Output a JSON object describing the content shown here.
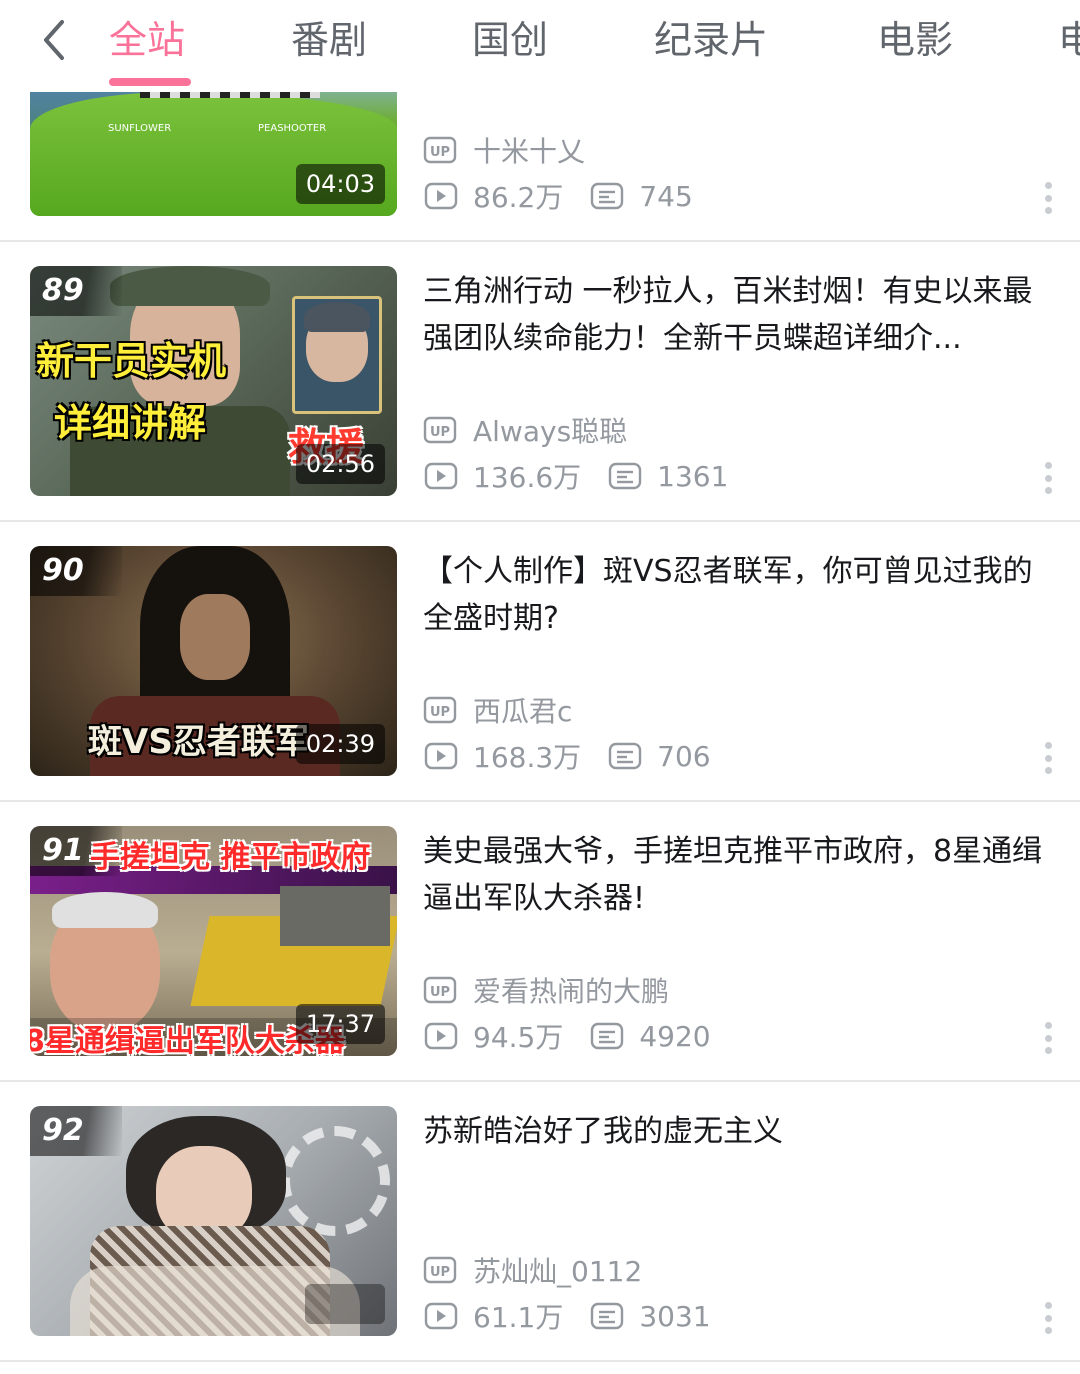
{
  "header": {
    "tabs": [
      {
        "label": "全站",
        "active": true
      },
      {
        "label": "番剧",
        "active": false
      },
      {
        "label": "国创",
        "active": false
      },
      {
        "label": "纪录片",
        "active": false
      },
      {
        "label": "电影",
        "active": false
      },
      {
        "label": "电",
        "active": false
      }
    ]
  },
  "colors": {
    "accent": "#fb7299",
    "meta": "#9499a0"
  },
  "icons": {
    "back": "chevron-left-icon",
    "uploader": "up-badge-icon",
    "views": "play-count-icon",
    "danmaku": "danmaku-count-icon",
    "more": "more-vertical-icon"
  },
  "items": [
    {
      "title": "",
      "uploader": "十米十乂",
      "views": "86.2万",
      "danmaku": "745",
      "duration": "04:03",
      "thumb_text": [
        "SUNFLOWER",
        "PEASHOOTER"
      ]
    },
    {
      "rank": "89",
      "title": "三角洲行动 一秒拉人，百米封烟！有史以来最强团队续命能力！全新干员蝶超详细介...",
      "uploader": "Always聪聪",
      "views": "136.6万",
      "danmaku": "1361",
      "duration": "02:56",
      "thumb_text": [
        "新干员实机",
        "详细讲解",
        "救援"
      ]
    },
    {
      "rank": "90",
      "title": "【个人制作】斑VS忍者联军，你可曾见过我的全盛时期?",
      "uploader": "西瓜君c",
      "views": "168.3万",
      "danmaku": "706",
      "duration": "02:39",
      "thumb_text": [
        "斑VS忍者联军"
      ]
    },
    {
      "rank": "91",
      "title": "美史最强大爷，手搓坦克推平市政府，8星通缉逼出军队大杀器!",
      "uploader": "爱看热闹的大鹏",
      "views": "94.5万",
      "danmaku": "4920",
      "duration": "17:37",
      "thumb_text": [
        "手搓坦克 推平市政府",
        "8星通缉逼出军队大杀器"
      ]
    },
    {
      "rank": "92",
      "title": "苏新皓治好了我的虚无主义",
      "uploader": "苏灿灿_0112",
      "views": "61.1万",
      "danmaku": "3031",
      "duration": ""
    }
  ]
}
